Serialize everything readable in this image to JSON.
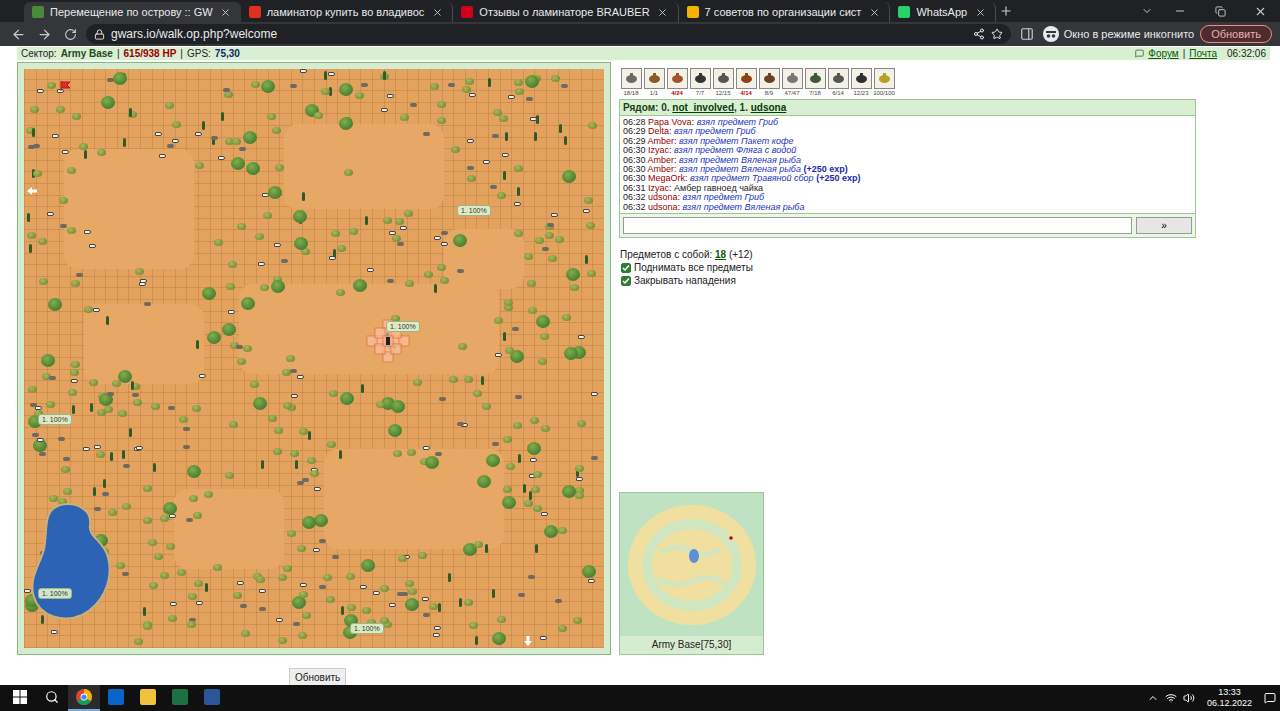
{
  "browser": {
    "tabs": [
      {
        "label": "Перемещение по острову :: GW",
        "selected": true,
        "color": "#4a8a3a"
      },
      {
        "label": "ламинатор купить во владивос",
        "selected": false,
        "color": "#e0301e"
      },
      {
        "label": "Отзывы о ламинаторе BRAUBER",
        "selected": false,
        "color": "#d0021b"
      },
      {
        "label": "7 советов по организации сист",
        "selected": false,
        "color": "#f4b400"
      },
      {
        "label": "WhatsApp",
        "selected": false,
        "color": "#25d366"
      }
    ],
    "url": "gwars.io/walk.op.php?welcome",
    "incognito": "Окно в режиме инкогнито",
    "update_button": "Обновить"
  },
  "header": {
    "sector_label": "Сектор:",
    "sector": "Army Base",
    "separator": "|",
    "hp": "615/938 HP",
    "gps_label": "GPS:",
    "gps": "75,30",
    "links": [
      "Форум",
      "Почта"
    ],
    "time": "06:32:06"
  },
  "map": {
    "markers": [
      "1. 100%",
      "1. 100%",
      "1. 100%",
      "1. 100%",
      "1. 100%"
    ]
  },
  "inventory": [
    {
      "count": "18/18",
      "low": false
    },
    {
      "count": "1/1",
      "low": false
    },
    {
      "count": "4/24",
      "low": true
    },
    {
      "count": "7/7",
      "low": false
    },
    {
      "count": "12/15",
      "low": false
    },
    {
      "count": "4/14",
      "low": true
    },
    {
      "count": "8/9",
      "low": false
    },
    {
      "count": "47/47",
      "low": false
    },
    {
      "count": "7/18",
      "low": false
    },
    {
      "count": "6/14",
      "low": false
    },
    {
      "count": "12/23",
      "low": false
    },
    {
      "count": "100/100",
      "low": false
    }
  ],
  "nearby": {
    "label": "Рядом:",
    "players": [
      {
        "index": "0.",
        "name": "not_involved"
      },
      {
        "index": "1.",
        "name": "udsona"
      }
    ]
  },
  "log": [
    {
      "time": "06:28",
      "name": "Papa Vova",
      "text": "взял предмет Гриб",
      "exp": "",
      "kind": "action",
      "color": "#990000"
    },
    {
      "time": "06:29",
      "name": "Delta",
      "text": "взял предмет Гриб",
      "exp": "",
      "kind": "action",
      "color": "#990000"
    },
    {
      "time": "06:29",
      "name": "Amber",
      "text": "взял предмет Пакет кофе",
      "exp": "",
      "kind": "action",
      "color": "#990000"
    },
    {
      "time": "06:30",
      "name": "Izyac",
      "text": "взял предмет Фляга с водой",
      "exp": "",
      "kind": "action",
      "color": "#990000"
    },
    {
      "time": "06:30",
      "name": "Amber",
      "text": "взял предмет Вяленая рыба",
      "exp": "",
      "kind": "action",
      "color": "#990000"
    },
    {
      "time": "06:30",
      "name": "Amber",
      "text": "взял предмет Вяленая рыба",
      "exp": "(+250 exp)",
      "kind": "action",
      "color": "#990000"
    },
    {
      "time": "06:30",
      "name": "MegaOrk",
      "text": "взял предмет Травяной сбор",
      "exp": "(+250 exp)",
      "kind": "action",
      "color": "#990000"
    },
    {
      "time": "06:31",
      "name": "Izyac",
      "text": "Амбер гавноед чайка",
      "exp": "",
      "kind": "chat",
      "color": "#990000"
    },
    {
      "time": "06:32",
      "name": "udsona",
      "text": "взял предмет Гриб",
      "exp": "",
      "kind": "action",
      "color": "#990000"
    },
    {
      "time": "06:32",
      "name": "udsona",
      "text": "взял предмет Вяленая рыба",
      "exp": "",
      "kind": "action",
      "color": "#990000"
    }
  ],
  "chat_input": {
    "value": "",
    "button": "»"
  },
  "items": {
    "label": "Предметов с собой:",
    "count": "18",
    "extra": "(+12)"
  },
  "options": [
    {
      "label": "Поднимать все предметы",
      "checked": true
    },
    {
      "label": "Закрывать нападения",
      "checked": true
    }
  ],
  "minimap": {
    "caption": "Army Base[75,30]"
  },
  "refresh_button": "Обновить",
  "taskbar": {
    "time": "13:33",
    "date": "06.12.2022"
  }
}
